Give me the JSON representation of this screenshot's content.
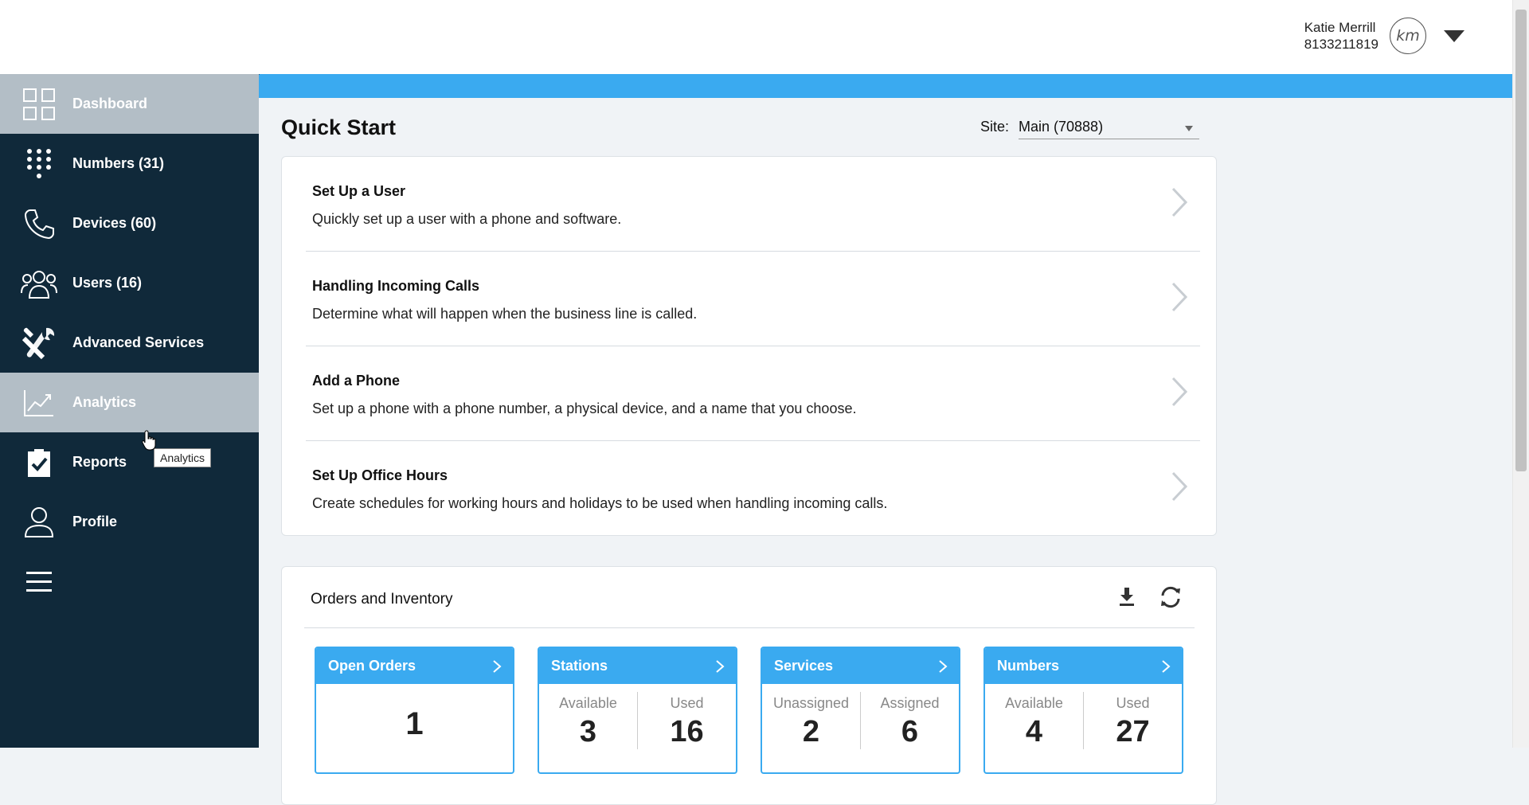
{
  "header": {
    "user_name": "Katie Merrill",
    "user_phone": "8133211819",
    "avatar_initials": "km"
  },
  "sidebar": {
    "items": [
      {
        "label": "Dashboard",
        "icon": "grid-icon"
      },
      {
        "label": "Numbers (31)",
        "icon": "dialpad-icon"
      },
      {
        "label": "Devices (60)",
        "icon": "phone-icon"
      },
      {
        "label": "Users (16)",
        "icon": "users-icon"
      },
      {
        "label": "Advanced Services",
        "icon": "tools-icon"
      },
      {
        "label": "Analytics",
        "icon": "chart-icon"
      },
      {
        "label": "Reports",
        "icon": "clipboard-check-icon"
      },
      {
        "label": "Profile",
        "icon": "person-icon"
      }
    ],
    "menu_icon": "hamburger-icon",
    "tooltip": "Analytics"
  },
  "quick_start": {
    "title": "Quick Start",
    "site_label": "Site:",
    "site_value": "Main (70888)",
    "items": [
      {
        "title": "Set Up a User",
        "desc": "Quickly set up a user with a phone and software."
      },
      {
        "title": "Handling Incoming Calls",
        "desc": "Determine what will happen when the business line is called."
      },
      {
        "title": "Add a Phone",
        "desc": "Set up a phone with a phone number, a physical device, and a name that you choose."
      },
      {
        "title": "Set Up Office Hours",
        "desc": "Create schedules for working hours and holidays to be used when handling incoming calls."
      }
    ]
  },
  "orders": {
    "title": "Orders and Inventory",
    "icons": [
      "download-icon",
      "refresh-icon"
    ],
    "tiles": [
      {
        "title": "Open Orders",
        "value": "1"
      },
      {
        "title": "Stations",
        "left_label": "Available",
        "left_value": "3",
        "right_label": "Used",
        "right_value": "16"
      },
      {
        "title": "Services",
        "left_label": "Unassigned",
        "left_value": "2",
        "right_label": "Assigned",
        "right_value": "6"
      },
      {
        "title": "Numbers",
        "left_label": "Available",
        "left_value": "4",
        "right_label": "Used",
        "right_value": "27"
      }
    ]
  },
  "colors": {
    "sidebar_bg": "#10293a",
    "accent_blue": "#3aaaf0",
    "active_item_bg": "#b3bec6"
  }
}
